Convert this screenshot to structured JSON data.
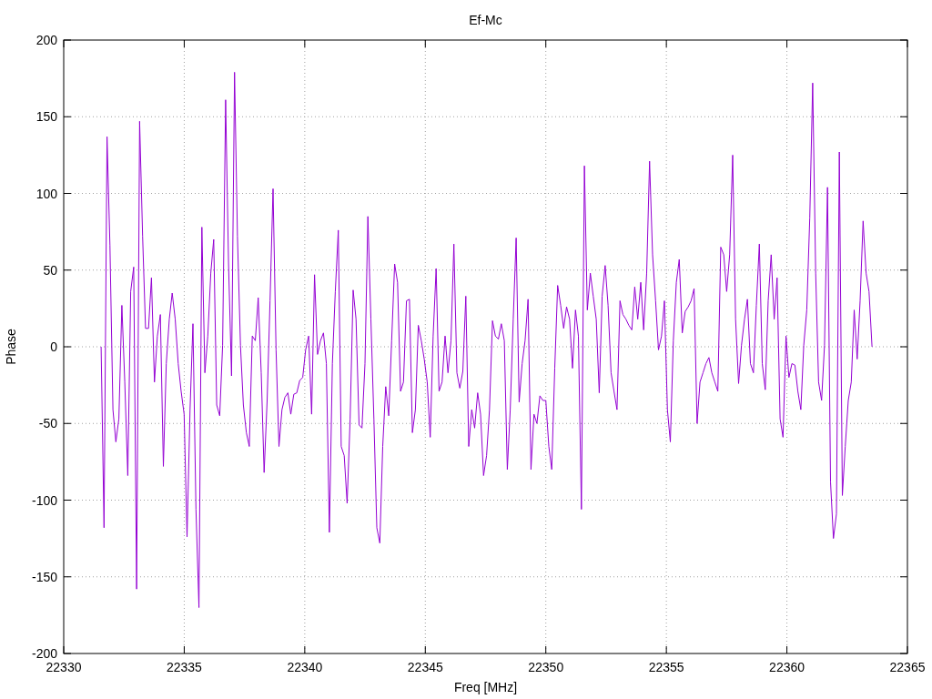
{
  "plot": {
    "chart_data": {
      "type": "line",
      "grid": true,
      "title": "Ef-Mc",
      "xlabel": "Freq [MHz]",
      "ylabel": "Phase",
      "xlim": [
        22330,
        22365
      ],
      "ylim": [
        -200,
        200
      ],
      "xticks": [
        22330,
        22335,
        22340,
        22345,
        22350,
        22355,
        22360,
        22365
      ],
      "yticks": [
        -200,
        -150,
        -100,
        -50,
        0,
        50,
        100,
        150,
        200
      ],
      "x": [
        22331.55,
        22331.673,
        22331.796,
        22331.919,
        22332.042,
        22332.165,
        22332.288,
        22332.411,
        22332.534,
        22332.657,
        22332.78,
        22332.903,
        22333.026,
        22333.149,
        22333.272,
        22333.395,
        22333.518,
        22333.641,
        22333.764,
        22333.887,
        22334.01,
        22334.133,
        22334.256,
        22334.379,
        22334.502,
        22334.625,
        22334.748,
        22334.871,
        22334.994,
        22335.117,
        22335.24,
        22335.363,
        22335.486,
        22335.609,
        22335.732,
        22335.855,
        22335.978,
        22336.101,
        22336.224,
        22336.347,
        22336.47,
        22336.593,
        22336.716,
        22336.839,
        22336.962,
        22337.085,
        22337.208,
        22337.331,
        22337.454,
        22337.577,
        22337.7,
        22337.823,
        22337.946,
        22338.069,
        22338.192,
        22338.315,
        22338.438,
        22338.561,
        22338.684,
        22338.807,
        22338.93,
        22339.053,
        22339.176,
        22339.299,
        22339.422,
        22339.545,
        22339.668,
        22339.791,
        22339.914,
        22340.037,
        22340.16,
        22340.283,
        22340.406,
        22340.529,
        22340.652,
        22340.775,
        22340.898,
        22341.021,
        22341.144,
        22341.267,
        22341.39,
        22341.513,
        22341.636,
        22341.759,
        22341.882,
        22342.005,
        22342.128,
        22342.251,
        22342.374,
        22342.497,
        22342.62,
        22342.743,
        22342.866,
        22342.989,
        22343.112,
        22343.235,
        22343.358,
        22343.481,
        22343.604,
        22343.727,
        22343.85,
        22343.973,
        22344.096,
        22344.219,
        22344.342,
        22344.465,
        22344.588,
        22344.711,
        22344.834,
        22344.957,
        22345.08,
        22345.203,
        22345.326,
        22345.449,
        22345.572,
        22345.695,
        22345.818,
        22345.941,
        22346.064,
        22346.187,
        22346.31,
        22346.433,
        22346.556,
        22346.679,
        22346.802,
        22346.925,
        22347.048,
        22347.171,
        22347.294,
        22347.417,
        22347.54,
        22347.663,
        22347.786,
        22347.909,
        22348.032,
        22348.155,
        22348.278,
        22348.401,
        22348.524,
        22348.647,
        22348.77,
        22348.893,
        22349.016,
        22349.139,
        22349.262,
        22349.385,
        22349.508,
        22349.631,
        22349.754,
        22349.877,
        22350.0,
        22350.123,
        22350.246,
        22350.369,
        22350.492,
        22350.615,
        22350.738,
        22350.861,
        22350.984,
        22351.107,
        22351.23,
        22351.353,
        22351.476,
        22351.599,
        22351.722,
        22351.845,
        22351.968,
        22352.091,
        22352.214,
        22352.337,
        22352.46,
        22352.583,
        22352.706,
        22352.829,
        22352.952,
        22353.075,
        22353.198,
        22353.321,
        22353.444,
        22353.567,
        22353.69,
        22353.813,
        22353.936,
        22354.059,
        22354.182,
        22354.305,
        22354.428,
        22354.551,
        22354.674,
        22354.797,
        22354.92,
        22355.043,
        22355.166,
        22355.289,
        22355.412,
        22355.535,
        22355.658,
        22355.781,
        22355.904,
        22356.027,
        22356.15,
        22356.273,
        22356.396,
        22356.519,
        22356.642,
        22356.765,
        22356.888,
        22357.011,
        22357.134,
        22357.257,
        22357.38,
        22357.503,
        22357.626,
        22357.749,
        22357.872,
        22357.995,
        22358.118,
        22358.241,
        22358.364,
        22358.487,
        22358.61,
        22358.733,
        22358.856,
        22358.979,
        22359.102,
        22359.225,
        22359.348,
        22359.471,
        22359.594,
        22359.717,
        22359.84,
        22359.963,
        22360.086,
        22360.209,
        22360.332,
        22360.455,
        22360.578,
        22360.701,
        22360.824,
        22360.947,
        22361.07,
        22361.193,
        22361.316,
        22361.439,
        22361.562,
        22361.685,
        22361.808,
        22361.931,
        22362.054,
        22362.177,
        22362.3,
        22362.423,
        22362.546,
        22362.669,
        22362.792,
        22362.915,
        22363.038,
        22363.161,
        22363.284,
        22363.407,
        22363.53
      ],
      "series": [
        {
          "color": "#9400d3",
          "values": [
            0,
            -118,
            137,
            66,
            -41,
            -62,
            -47,
            27,
            -23,
            -84,
            36,
            52,
            -158,
            147,
            72,
            12,
            12,
            45,
            -23,
            7,
            21,
            -78,
            -11,
            18,
            35,
            18,
            -11,
            -29,
            -44,
            -124,
            -41,
            15,
            -106,
            -170,
            78,
            -17,
            7,
            48,
            70,
            -38,
            -45,
            1,
            161,
            54,
            -19,
            179,
            72,
            1,
            -38,
            -56,
            -65,
            7,
            4,
            32,
            -17,
            -82,
            -35,
            30,
            103,
            -2,
            -65,
            -41,
            -33,
            -30,
            -44,
            -31,
            -30,
            -22,
            -20,
            -2,
            7,
            -44,
            47,
            -5,
            4,
            9,
            -11,
            -121,
            -11,
            36,
            76,
            -65,
            -71,
            -102,
            -47,
            37,
            18,
            -51,
            -53,
            -11,
            85,
            18,
            -47,
            -118,
            -128,
            -65,
            -26,
            -45,
            4,
            54,
            42,
            -29,
            -23,
            30,
            31,
            -56,
            -41,
            14,
            4,
            -8,
            -23,
            -59,
            7,
            51,
            -29,
            -23,
            7,
            -17,
            4,
            67,
            -17,
            -27,
            -16,
            33,
            -65,
            -41,
            -53,
            -30,
            -44,
            -84,
            -71,
            -41,
            17,
            7,
            5,
            15,
            4,
            -80,
            -41,
            18,
            71,
            -36,
            -11,
            4,
            31,
            -80,
            -44,
            -50,
            -32,
            -35,
            -35,
            -65,
            -80,
            -14,
            40,
            27,
            12,
            26,
            18,
            -14,
            24,
            7,
            -106,
            118,
            24,
            48,
            33,
            18,
            -30,
            33,
            53,
            27,
            -17,
            -29,
            -41,
            30,
            21,
            18,
            14,
            11,
            39,
            18,
            42,
            11,
            48,
            121,
            60,
            30,
            -2,
            7,
            30,
            -41,
            -62,
            4,
            42,
            57,
            9,
            23,
            26,
            30,
            38,
            -50,
            -23,
            -17,
            -11,
            -7,
            -17,
            -23,
            -29,
            65,
            60,
            36,
            60,
            125,
            18,
            -24,
            1,
            18,
            31,
            -11,
            -17,
            27,
            67,
            -11,
            -28,
            30,
            60,
            18,
            45,
            -47,
            -59,
            7,
            -20,
            -11,
            -12,
            -29,
            -41,
            1,
            24,
            84,
            172,
            48,
            -23,
            -35,
            1,
            104,
            -88,
            -125,
            -109,
            127,
            -97,
            -65,
            -35,
            -23,
            24,
            -8,
            30,
            82,
            48,
            36,
            0
          ]
        }
      ]
    }
  }
}
